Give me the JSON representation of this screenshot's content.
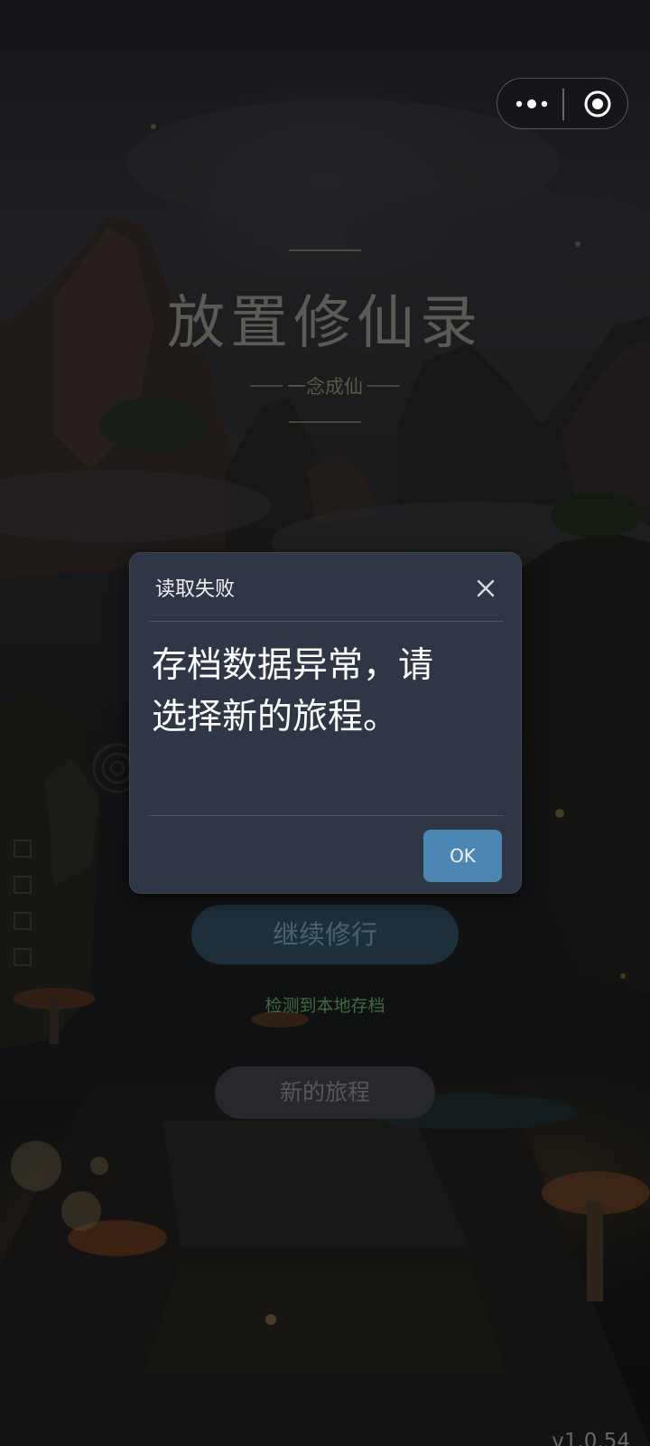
{
  "capsule": {
    "more_icon": "more-dots-icon",
    "close_icon": "target-circle-icon"
  },
  "game": {
    "title": "放置修仙录",
    "subtitle": "一念成仙",
    "continue_label": "继续修行",
    "save_hint": "检测到本地存档",
    "new_journey_label": "新的旅程",
    "version": "v1.0.54"
  },
  "dialog": {
    "title": "读取失败",
    "message": "存档数据异常，请选择新的旅程。",
    "ok_label": "OK",
    "close_icon": "close-icon"
  }
}
